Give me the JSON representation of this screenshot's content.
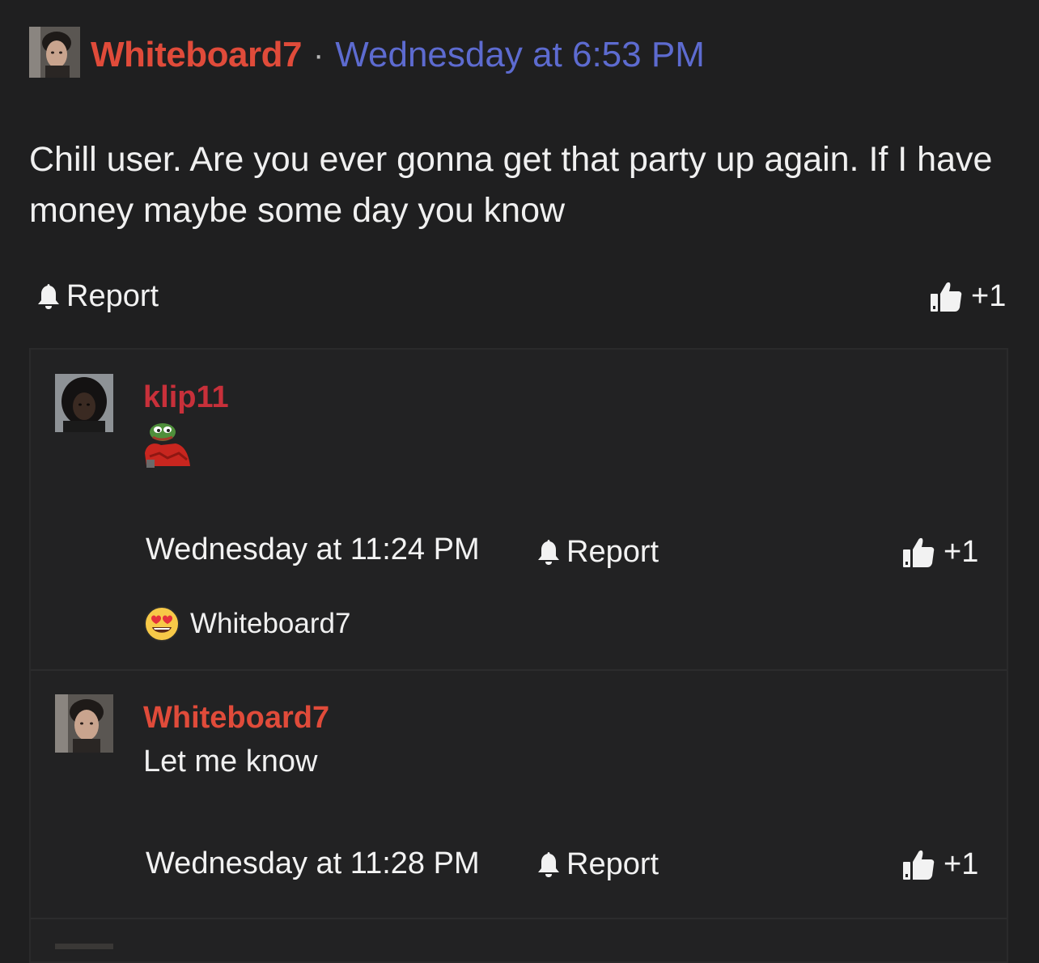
{
  "post": {
    "username": "Whiteboard7",
    "separator": "·",
    "timestamp": "Wednesday at 6:53 PM",
    "body": "Chill user. Are you ever gonna get that party up again. If I have money maybe some day you know",
    "report_label": "Report",
    "like_count": "+1"
  },
  "replies": [
    {
      "username": "klip11",
      "sticker": "pepe-sticker",
      "timestamp": "Wednesday at 11:24 PM",
      "report_label": "Report",
      "like_count": "+1",
      "reaction": {
        "emoji": "heart-eyes",
        "user": "Whiteboard7"
      }
    },
    {
      "username": "Whiteboard7",
      "text": "Let me know",
      "timestamp": "Wednesday at 11:28 PM",
      "report_label": "Report",
      "like_count": "+1"
    }
  ],
  "colors": {
    "background": "#1f1f20",
    "username_primary": "#e04b3a",
    "username_klip": "#c8303a",
    "timestamp_link": "#5d6bd0"
  }
}
